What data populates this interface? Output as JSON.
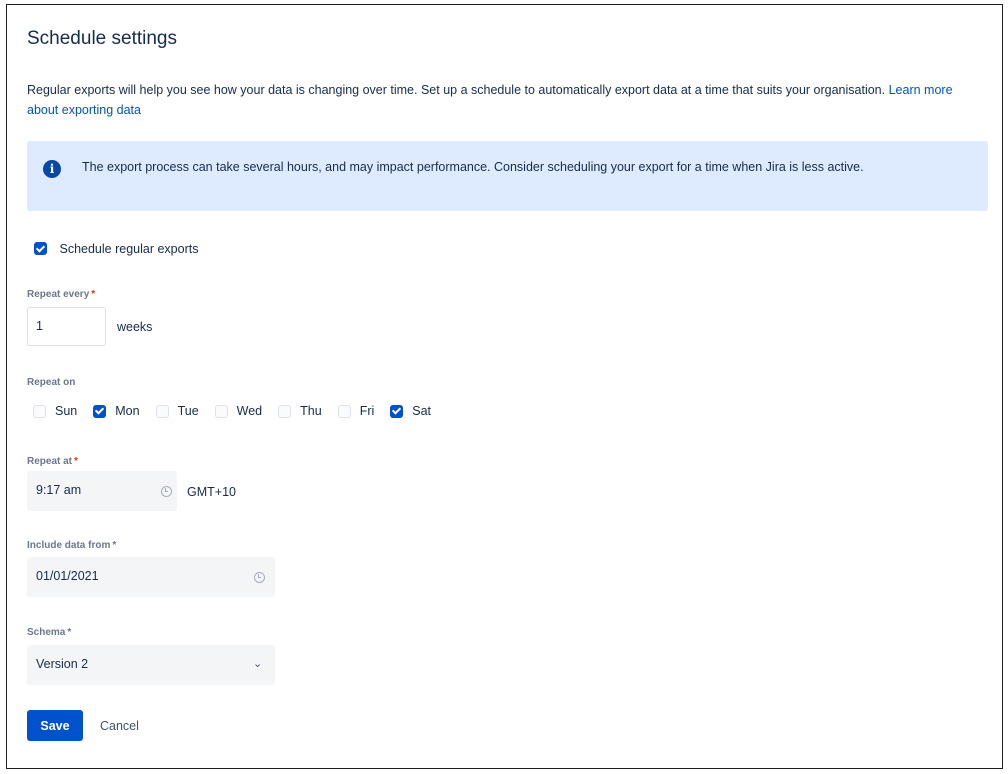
{
  "title": "Schedule settings",
  "description": {
    "text": "Regular exports will help you see how your data is changing over time. Set up a schedule to automatically export data at a time that suits your organisation.",
    "link": "Learn more about exporting data"
  },
  "info_banner": {
    "icon": "info-icon",
    "text": "The export process can take several hours, and may impact performance. Consider scheduling your export for a time when Jira is less active."
  },
  "schedule_checkbox": {
    "label": "Schedule regular exports",
    "checked": true
  },
  "repeat_every": {
    "label": "Repeat every",
    "required": "*",
    "value": "1",
    "units": "weeks"
  },
  "repeat_on": {
    "label": "Repeat on",
    "days": [
      {
        "label": "Sun",
        "checked": false
      },
      {
        "label": "Mon",
        "checked": true
      },
      {
        "label": "Tue",
        "checked": false
      },
      {
        "label": "Wed",
        "checked": false
      },
      {
        "label": "Thu",
        "checked": false
      },
      {
        "label": "Fri",
        "checked": false
      },
      {
        "label": "Sat",
        "checked": true
      }
    ]
  },
  "repeat_at": {
    "label": "Repeat at",
    "required": "*",
    "value": "9:17 am",
    "timezone": "GMT+10"
  },
  "include_from": {
    "label": "Include data from",
    "required": "*",
    "value": "01/01/2021"
  },
  "schema": {
    "label": "Schema",
    "required": "*",
    "value": "Version 2"
  },
  "buttons": {
    "save": "Save",
    "cancel": "Cancel"
  },
  "colors": {
    "primary": "#0052cc",
    "banner_bg": "#deebff",
    "required": "#de350b"
  }
}
